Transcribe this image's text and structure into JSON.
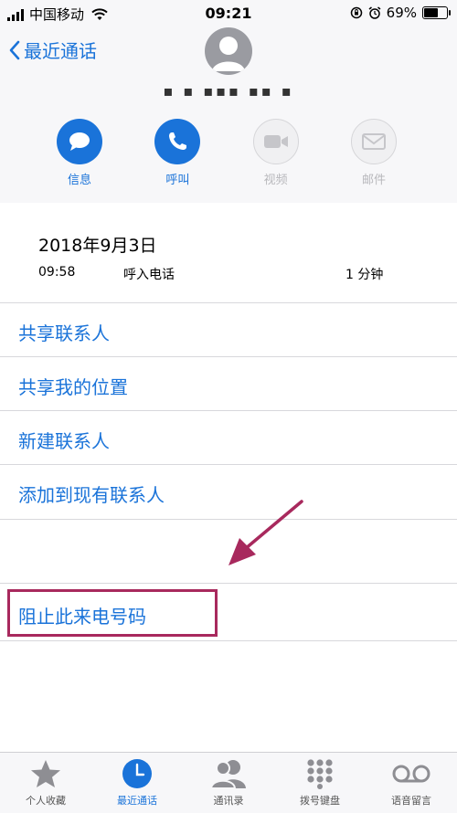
{
  "status": {
    "carrier": "中国移动",
    "time": "09:21",
    "battery_pct": "69%",
    "battery_level": 0.69
  },
  "header": {
    "back_label": "最近通话",
    "caller_name": "▪ ▪ ▪▪▪ ▪▪ ▪",
    "actions": [
      {
        "label": "信息",
        "icon": "message-icon",
        "enabled": true
      },
      {
        "label": "呼叫",
        "icon": "phone-icon",
        "enabled": true
      },
      {
        "label": "视频",
        "icon": "video-icon",
        "enabled": false
      },
      {
        "label": "邮件",
        "icon": "mail-icon",
        "enabled": false
      }
    ]
  },
  "call_detail": {
    "date": "2018年9月3日",
    "time": "09:58",
    "type": "呼入电话",
    "duration": "1 分钟"
  },
  "menu": {
    "items": [
      "共享联系人",
      "共享我的位置",
      "新建联系人",
      "添加到现有联系人"
    ],
    "block_label": "阻止此来电号码"
  },
  "tabbar": {
    "tabs": [
      {
        "label": "个人收藏",
        "icon": "star-icon",
        "active": false
      },
      {
        "label": "最近通话",
        "icon": "clock-icon",
        "active": true
      },
      {
        "label": "通讯录",
        "icon": "contacts-icon",
        "active": false
      },
      {
        "label": "拨号键盘",
        "icon": "keypad-icon",
        "active": false
      },
      {
        "label": "语音留言",
        "icon": "voicemail-icon",
        "active": false
      }
    ]
  },
  "colors": {
    "accent": "#1a73d9",
    "highlight": "#a8295d"
  }
}
